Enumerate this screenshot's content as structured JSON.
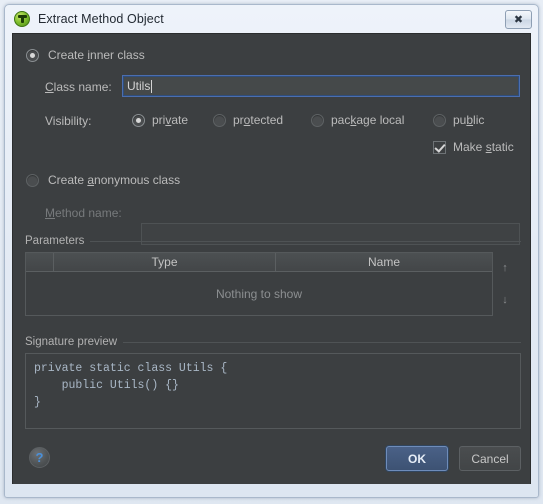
{
  "window": {
    "title": "Extract Method Object",
    "app_icon": "intellij-green-icon",
    "close_label": "✖"
  },
  "inner_class": {
    "radio_label_pre": "Create ",
    "radio_label_mnemonic": "i",
    "radio_label_post": "nner class",
    "radio_label": "Create inner class",
    "selected": true,
    "class_name_label_mnemonic": "C",
    "class_name_label_post": "lass name:",
    "class_name_label": "Class name:",
    "class_name_value": "Utils"
  },
  "visibility": {
    "label": "Visibility:",
    "options": [
      {
        "pre": "pri",
        "mn": "v",
        "post": "ate",
        "label": "private",
        "selected": true
      },
      {
        "pre": "pr",
        "mn": "o",
        "post": "tected",
        "label": "protected",
        "selected": false
      },
      {
        "pre": "pac",
        "mn": "k",
        "post": "age local",
        "label": "package local",
        "selected": false
      },
      {
        "pre": "pu",
        "mn": "b",
        "post": "lic",
        "label": "public",
        "selected": false
      }
    ],
    "make_static": {
      "pre": "Make ",
      "mn": "s",
      "post": "tatic",
      "label": "Make static",
      "checked": true
    }
  },
  "anonymous_class": {
    "radio_label_pre": "Create ",
    "radio_label_mnemonic": "a",
    "radio_label_post": "nonymous class",
    "radio_label": "Create anonymous class",
    "selected": false,
    "method_name_label_mnemonic": "M",
    "method_name_label_post": "ethod name:",
    "method_name_label": "Method name:",
    "method_name_value": "",
    "enabled": false
  },
  "parameters": {
    "group_label": "Parameters",
    "columns": [
      "",
      "Type",
      "Name"
    ],
    "rows": [],
    "empty_text": "Nothing to show",
    "move_up_icon": "↑",
    "move_down_icon": "↓"
  },
  "signature_preview": {
    "group_label": "Signature preview",
    "code": "private static class Utils {\n    public Utils() {}\n}"
  },
  "footer": {
    "help_icon": "?",
    "ok_label": "OK",
    "cancel_label": "Cancel"
  }
}
